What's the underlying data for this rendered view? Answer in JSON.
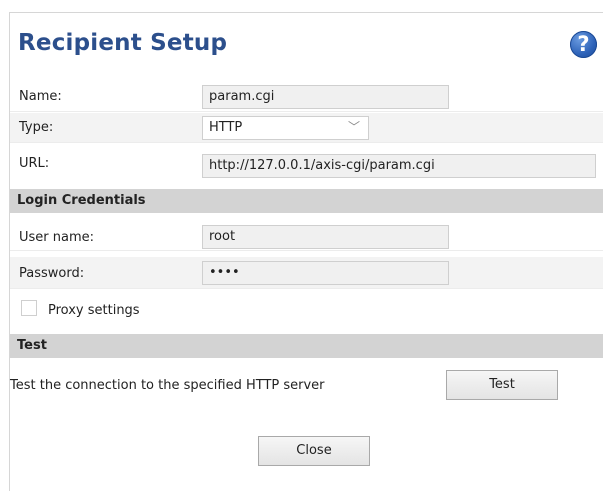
{
  "dialog": {
    "title": "Recipient Setup",
    "help_icon": "question-circle-icon",
    "help_glyph": "?"
  },
  "recipient": {
    "name_label": "Name:",
    "name_value": "param.cgi",
    "type_label": "Type:",
    "type_value": "HTTP",
    "url_label": "URL:",
    "url_value": "http://127.0.0.1/axis-cgi/param.cgi"
  },
  "login": {
    "section_title": "Login Credentials",
    "username_label": "User name:",
    "username_value": "root",
    "password_label": "Password:",
    "password_value": "••••"
  },
  "proxy": {
    "label": "Proxy settings",
    "checked": false
  },
  "test": {
    "section_title": "Test",
    "description": "Test the connection to the specified HTTP server",
    "button_label": "Test"
  },
  "footer": {
    "close_label": "Close"
  },
  "colors": {
    "title": "#2c4f8c",
    "section_bg": "#d3d3d3",
    "help_icon": "#2d62b8"
  }
}
